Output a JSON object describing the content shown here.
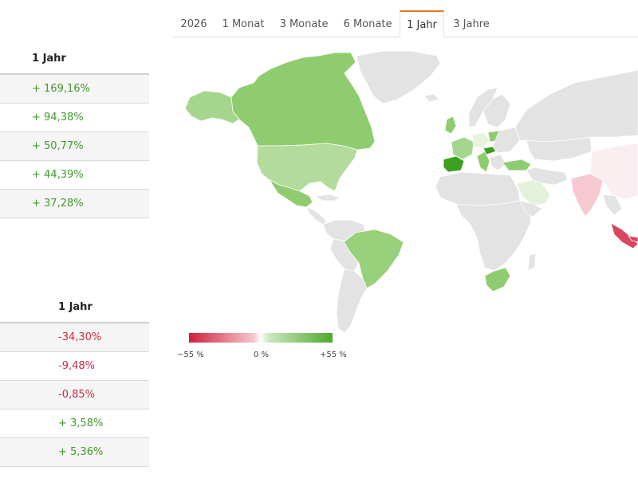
{
  "tabs": [
    {
      "label": "2026"
    },
    {
      "label": "1 Monat"
    },
    {
      "label": "3 Monate"
    },
    {
      "label": "6 Monate"
    },
    {
      "label": "1 Jahr",
      "active": true
    },
    {
      "label": "3 Jahre"
    }
  ],
  "top_table": {
    "header": "1 Jahr",
    "rows": [
      "+ 169,16%",
      "+ 94,38%",
      "+ 50,77%",
      "+ 44,39%",
      "+ 37,28%"
    ]
  },
  "bottom_table": {
    "header": "1 Jahr",
    "rows": [
      "-34,30%",
      "-9,48%",
      "-0,85%",
      "+ 3,58%",
      "+ 5,36%"
    ]
  },
  "legend": {
    "min_label": "−55 %",
    "mid_label": "0 %",
    "max_label": "+55 %",
    "min_color": "#d01f3c",
    "mid_color": "#ffffff",
    "max_color": "#4fa82c"
  },
  "colors": {
    "positive_text": "#3f9a2b",
    "negative_text": "#cc2a41",
    "active_tab_accent": "#e8731e",
    "neutral_country": "#e3e3e3"
  }
}
